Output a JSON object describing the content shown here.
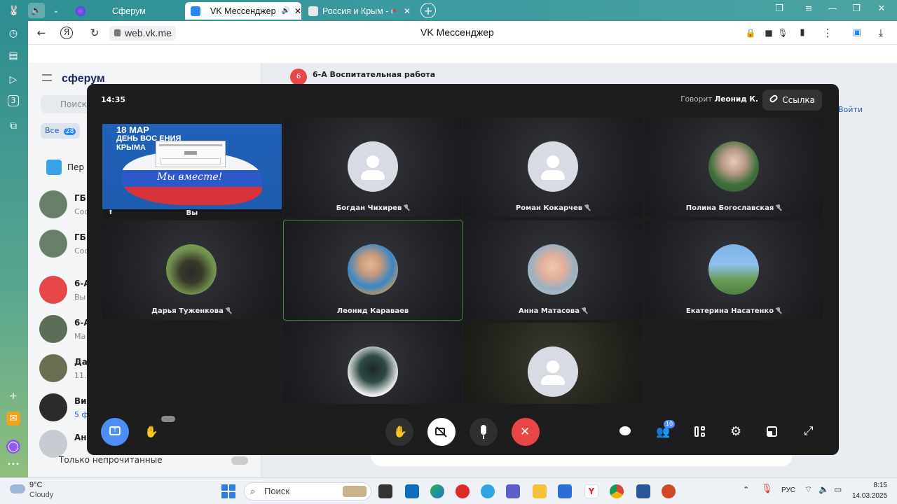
{
  "browser": {
    "tabs": [
      {
        "title": "Сферум",
        "active": false
      },
      {
        "title": "VK Мессенджер",
        "active": true
      },
      {
        "title": "Россия и Крым - сно",
        "active": false
      }
    ],
    "url": "web.vk.me",
    "page_title": "VK Мессенджер"
  },
  "vk": {
    "logo": "сферум",
    "search_placeholder": "Поиск",
    "filter_all": "Все",
    "filter_all_count": "28",
    "pinned_label": "Пер",
    "chats": [
      {
        "name": "ГБ",
        "sub": "Соо"
      },
      {
        "name": "ГБ",
        "sub": "Соо"
      },
      {
        "name": "6-А",
        "sub": "Вы"
      },
      {
        "name": "6-А",
        "sub": "Ма"
      },
      {
        "name": "Да",
        "sub": "11."
      },
      {
        "name": "Ви",
        "sub": "5 ф"
      },
      {
        "name": "Ан",
        "sub": ""
      }
    ],
    "unread_only": "Только непрочитанные",
    "chat_title": "6-А Воспитательная работа",
    "chat_badge": "6",
    "join_label": "Войти"
  },
  "call": {
    "time": "14:35",
    "speaking_prefix": "Говорит",
    "speaking_name": "Леонид К.",
    "link_label": "Ссылка",
    "my_tile_label": "Вы",
    "share": {
      "title_line1": "18 МАР",
      "title_line2": "ДЕНЬ ВОС        ЕНИЯ",
      "title_line3": "КРЫМА",
      "slogan": "Мы вместе!"
    },
    "participants": [
      {
        "name": "Богдан Чихирев",
        "avatar": "placeholder",
        "muted": true
      },
      {
        "name": "Роман Кокарчев",
        "avatar": "placeholder",
        "muted": true
      },
      {
        "name": "Полина Богославская",
        "avatar": "photo",
        "muted": true
      },
      {
        "name": "Дарья Туженкова",
        "avatar": "photo",
        "muted": true
      },
      {
        "name": "Леонид Караваев",
        "avatar": "photo",
        "muted": false
      },
      {
        "name": "Анна Матасова",
        "avatar": "photo",
        "muted": true
      },
      {
        "name": "Екатерина Насатенко",
        "avatar": "photo",
        "muted": true
      },
      {
        "name": "",
        "avatar": "photo",
        "muted": false
      },
      {
        "name": "",
        "avatar": "placeholder",
        "muted": false
      }
    ],
    "people_count": "10",
    "colors": {
      "end_call": "#e64646",
      "screen_share": "#4c8df6",
      "speaking_outline": "#3b8a3b"
    }
  },
  "taskbar": {
    "weather_temp": "9°C",
    "weather_desc": "Cloudy",
    "search_placeholder": "Поиск",
    "lang": "РУС",
    "time": "8:15",
    "date": "14.03.2025"
  }
}
